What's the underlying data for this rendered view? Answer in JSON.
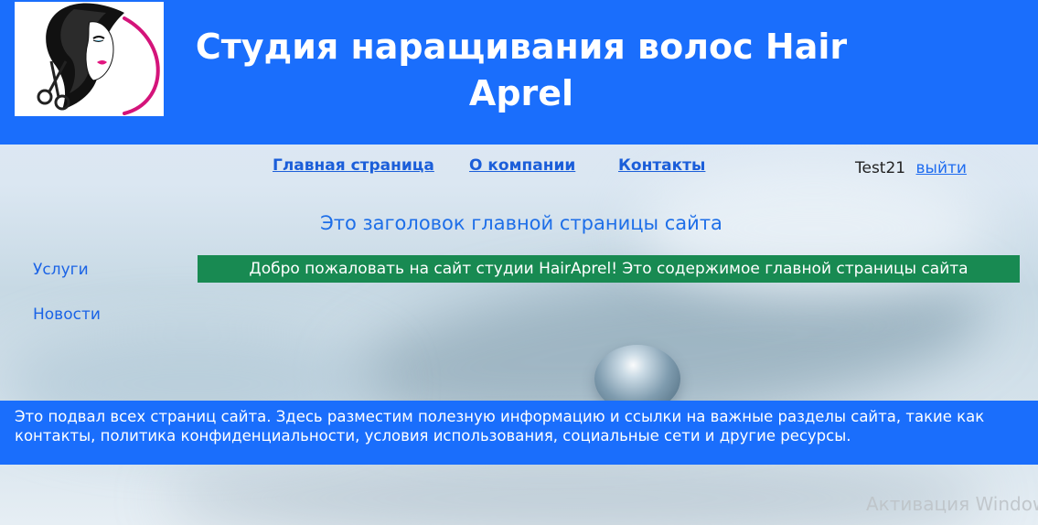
{
  "header": {
    "site_title": "Студия наращивания волос Hair Aprel",
    "logo_icon": "woman-face-scissors-logo",
    "background_color": "#1a6efc"
  },
  "nav": {
    "items": [
      {
        "label": "Главная страница"
      },
      {
        "label": "О компании"
      },
      {
        "label": "Контакты"
      }
    ],
    "user_name": "Test21",
    "logout_label": "выйти"
  },
  "main": {
    "heading": "Это заголовок главной страницы сайта",
    "welcome_text": "Добро пожаловать на сайт студии HairAprel! Это содержимое главной страницы сайта",
    "welcome_color": "#188a52"
  },
  "sidebar": {
    "items": [
      {
        "label": "Услуги"
      },
      {
        "label": "Новости"
      }
    ]
  },
  "footer": {
    "text": "Это подвал всех страниц сайта. Здесь разместим полезную информацию и ссылки на важные разделы сайта, такие как контакты, политика конфиденциальности, условия использования, социальные сети и другие ресурсы."
  },
  "os_overlay": {
    "watermark": "Активация Windows"
  }
}
